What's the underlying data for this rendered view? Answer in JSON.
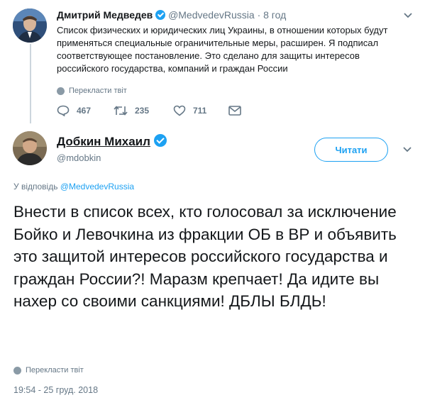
{
  "quoted": {
    "name": "Дмитрий Медведев",
    "handle": "@MedvedevRussia",
    "dot": "·",
    "time": "8 год",
    "text": "Список физических и юридических лиц Украины, в отношении которых будут применяться специальные ограничительные меры, расширен. Я подписал соответствующее постановление. Это сделано для защиты интересов российского государства, компаний и граждан России",
    "translate": "Перекласти твіт",
    "replies": "467",
    "retweets": "235",
    "likes": "711"
  },
  "reply": {
    "name": "Добкин Михаил",
    "handle": "@mdobkin",
    "follow_label": "Читати",
    "in_reply_prefix": "У відповідь",
    "in_reply_handle": "@MedvedevRussia",
    "text": "Внести в список всех, кто голосовал за исключение Бойко и Левочкина из фракции ОБ в ВР и объявить это защитой интересов российского государства и граждан России?! Маразм крепчает! Да идите вы нахер со своими санкциями! ДБЛЫ БЛДЬ!",
    "translate": "Перекласти твіт",
    "timestamp": "19:54 - 25 груд. 2018"
  },
  "colors": {
    "accent": "#1da1f2",
    "muted": "#657786",
    "divider": "#e6ecf0"
  },
  "icons": [
    "chevron-down-icon",
    "verified-icon",
    "reply-icon",
    "retweet-icon",
    "like-icon",
    "message-icon",
    "globe-icon"
  ]
}
